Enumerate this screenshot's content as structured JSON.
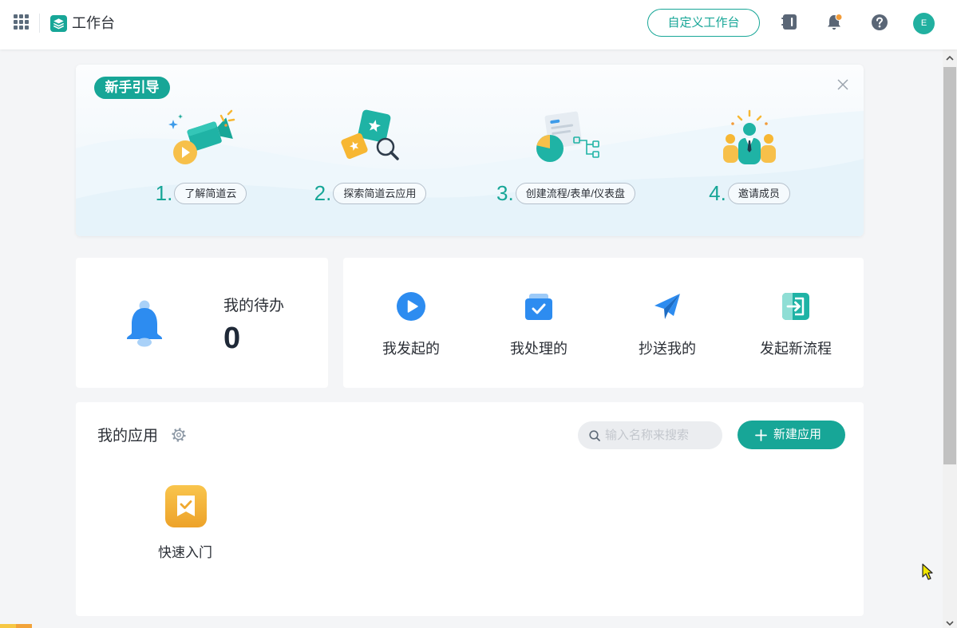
{
  "colors": {
    "accent": "#17a697",
    "blue": "#2d8cf0",
    "yellow": "#f7b733",
    "page_background": "#f4f5f7"
  },
  "header": {
    "title": "工作台",
    "customize_label": "自定义工作台",
    "avatar_initial": "E",
    "icons": [
      "apps-grid-icon",
      "workspace-logo-icon",
      "notebook-icon",
      "notification-bell-icon",
      "help-icon"
    ]
  },
  "guide": {
    "badge": "新手引导",
    "steps": [
      {
        "number": "1.",
        "label": "了解简道云",
        "icon": "video-camera-illustration"
      },
      {
        "number": "2.",
        "label": "探索简道云应用",
        "icon": "explore-apps-illustration"
      },
      {
        "number": "3.",
        "label": "创建流程/表单/仪表盘",
        "icon": "chart-form-illustration"
      },
      {
        "number": "4.",
        "label": "邀请成员",
        "icon": "team-members-illustration"
      }
    ]
  },
  "todo": {
    "label": "我的待办",
    "count": 0,
    "icon": "bell-icon"
  },
  "process": {
    "items": [
      {
        "label": "我发起的",
        "icon": "play-circle-icon"
      },
      {
        "label": "我处理的",
        "icon": "inbox-check-icon"
      },
      {
        "label": "抄送我的",
        "icon": "paper-plane-icon"
      },
      {
        "label": "发起新流程",
        "icon": "start-flow-icon"
      }
    ]
  },
  "apps": {
    "title": "我的应用",
    "search_placeholder": "输入名称来搜索",
    "new_app_label": "新建应用",
    "items": [
      {
        "name": "快速入门",
        "icon": "quick-start-icon"
      }
    ]
  }
}
